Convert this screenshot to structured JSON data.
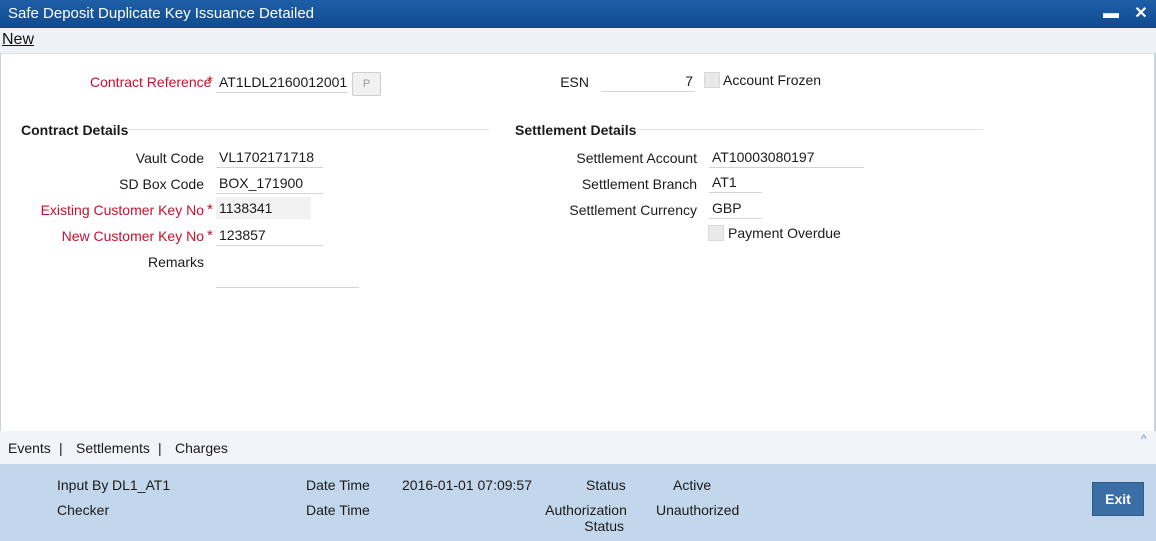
{
  "window": {
    "title": "Safe Deposit Duplicate Key Issuance Detailed",
    "minimize_glyph": "▬",
    "close_glyph": "✕"
  },
  "menu": {
    "new_label": "New"
  },
  "header": {
    "contract_reference_label": "Contract Reference",
    "contract_reference_value": "AT1LDL2160012001",
    "p_button_label": "P",
    "esn_label": "ESN",
    "esn_value": "7",
    "account_frozen_label": "Account Frozen",
    "required_marker": "*"
  },
  "contract_details": {
    "section_title": "Contract Details",
    "vault_code_label": "Vault Code",
    "vault_code_value": "VL1702171718",
    "sd_box_code_label": "SD Box Code",
    "sd_box_code_value": "BOX_171900",
    "existing_key_label": "Existing Customer Key No",
    "existing_key_value": "1138341",
    "new_key_label": "New Customer Key No",
    "new_key_value": "123857",
    "remarks_label": "Remarks",
    "remarks_value": ""
  },
  "settlement_details": {
    "section_title": "Settlement Details",
    "account_label": "Settlement Account",
    "account_value": "AT10003080197",
    "branch_label": "Settlement Branch",
    "branch_value": "AT1",
    "currency_label": "Settlement Currency",
    "currency_value": "GBP",
    "payment_overdue_label": "Payment Overdue"
  },
  "tabs": {
    "events": "Events",
    "settlements": "Settlements",
    "charges": "Charges",
    "separator": "|",
    "collapse_glyph": "^"
  },
  "footer": {
    "input_by_label": "Input By",
    "input_by_value": "DL1_AT1",
    "checker_label": "Checker",
    "date_time_label_1": "Date Time",
    "date_time_value_1": "2016-01-01 07:09:57",
    "date_time_label_2": "Date Time",
    "status_label": "Status",
    "status_value": "Active",
    "auth_status_label_line1": "Authorization",
    "auth_status_label_line2": "Status",
    "auth_status_value": "Unauthorized",
    "exit_label": "Exit"
  },
  "colors": {
    "title_bar": "#1a5aa0",
    "required_label": "#c8102e",
    "footer_bg": "#c3d7ec",
    "exit_button": "#3a6ea5"
  }
}
